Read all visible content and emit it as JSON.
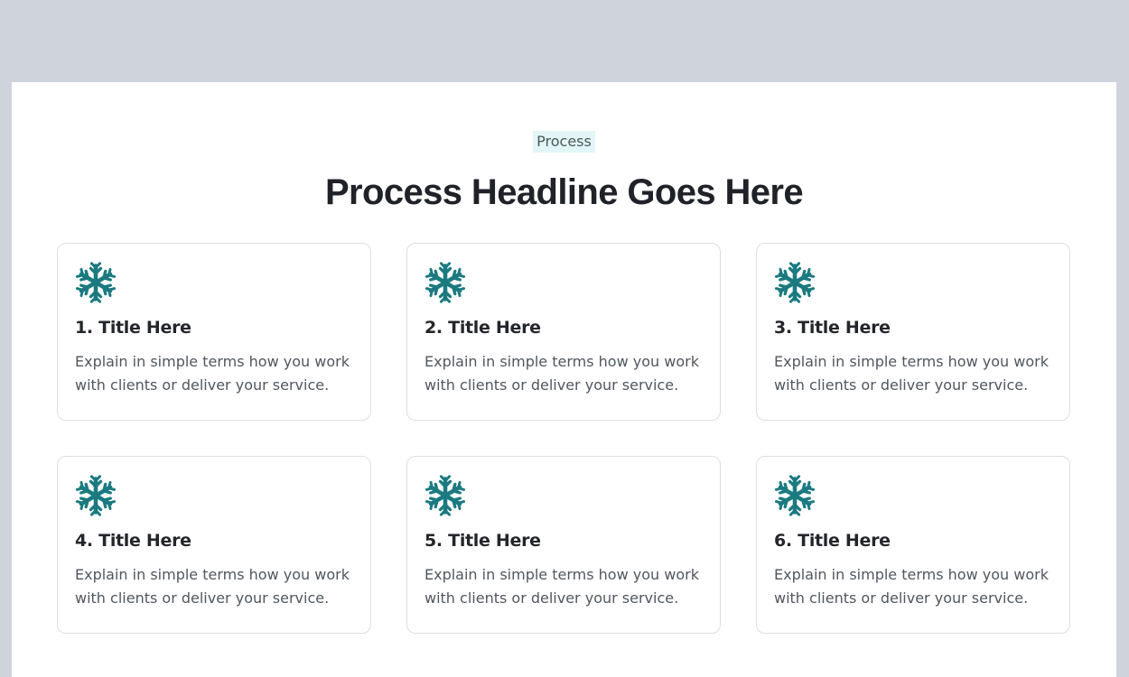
{
  "section": {
    "eyebrow": "Process",
    "headline": "Process Headline Goes Here"
  },
  "theme": {
    "page_background": "#cfd4dc",
    "panel_background": "#ffffff",
    "eyebrow_background": "#e3f6f7",
    "icon_color": "#1b7a80",
    "heading_color": "#1f2228",
    "body_color": "#50575f",
    "card_border": "#dcdfe3"
  },
  "steps": [
    {
      "icon": "snowflake-icon",
      "title": "1. Title Here",
      "body": "Explain in simple terms how you work with clients or deliver your service."
    },
    {
      "icon": "snowflake-icon",
      "title": "2. Title Here",
      "body": "Explain in simple terms how you work with clients or deliver your service."
    },
    {
      "icon": "snowflake-icon",
      "title": "3. Title Here",
      "body": "Explain in simple terms how you work with clients or deliver your service."
    },
    {
      "icon": "snowflake-icon",
      "title": "4. Title Here",
      "body": "Explain in simple terms how you work with clients or deliver your service."
    },
    {
      "icon": "snowflake-icon",
      "title": "5. Title Here",
      "body": "Explain in simple terms how you work with clients or deliver your service."
    },
    {
      "icon": "snowflake-icon",
      "title": "6. Title Here",
      "body": "Explain in simple terms how you work with clients or deliver your service."
    }
  ]
}
